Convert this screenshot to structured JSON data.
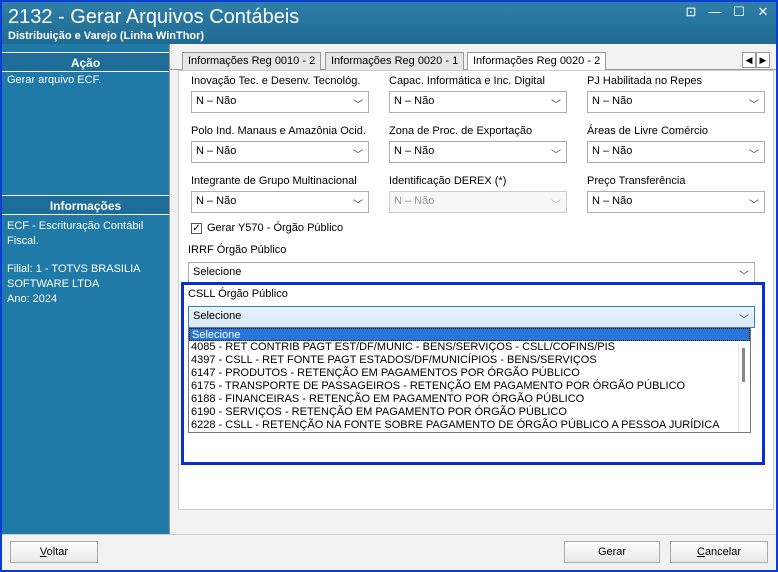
{
  "window": {
    "title": "2132 - Gerar Arquivos Contábeis",
    "subtitle": "Distribuição e Varejo (Linha WinThor)",
    "controls": [
      "⊡",
      "—",
      "☐",
      "✕"
    ]
  },
  "sidebar": {
    "acao_header": "Ação",
    "acao_text": "Gerar arquivo ECF.",
    "info_header": "Informações",
    "info_line1": "ECF - Escrituração Contábil",
    "info_line2": "Fiscal.",
    "info_line3": "Filial: 1 - TOTVS BRASILIA",
    "info_line4": "SOFTWARE LTDA",
    "info_line5": "Ano: 2024"
  },
  "tabs": [
    {
      "label": "Informações Reg 0010 - 2"
    },
    {
      "label": "Informações Reg 0020 - 1"
    },
    {
      "label": "Informações Reg 0020 - 2"
    }
  ],
  "tab_arrows": {
    "left": "◀",
    "right": "▶"
  },
  "fields": {
    "inovacao": {
      "label": "Inovação Tec. e Desenv. Tecnológ.",
      "value": "N – Não"
    },
    "capac": {
      "label": "Capac. Informática e Inc. Digital",
      "value": "N – Não"
    },
    "pj_repes": {
      "label": "PJ Habilitada no Repes",
      "value": "N – Não"
    },
    "polo": {
      "label": "Polo Ind. Manaus e Amazônia Ocid.",
      "value": "N – Não"
    },
    "zona": {
      "label": "Zona de Proc. de Exportação",
      "value": "N – Não"
    },
    "areas": {
      "label": "Áreas de Livre Comércio",
      "value": "N – Não"
    },
    "integrante": {
      "label": "Integrante de Grupo Multinacional",
      "value": "N – Não"
    },
    "derex": {
      "label": "Identificação DEREX (*)",
      "value": "N – Não"
    },
    "preco": {
      "label": "Preço Transferência",
      "value": "N – Não"
    }
  },
  "gerar_y570": {
    "label": "Gerar Y570 - Órgão Público",
    "checked": "✓"
  },
  "irrf": {
    "label": "IRRF Órgão Público",
    "value": "Selecione"
  },
  "csll": {
    "label": "CSLL Órgão Público",
    "value": "Selecione"
  },
  "csll_options": [
    "Selecione",
    "4085 - RET CONTRIB PAGT EST/DF/MUNIC - BENS/SERVIÇOS - CSLL/COFINS/PIS",
    "4397 - CSLL - RET FONTE PAGT ESTADOS/DF/MUNICÍPIOS - BENS/SERVIÇOS",
    "6147 - PRODUTOS - RETENÇÃO EM PAGAMENTOS POR ÓRGÃO PÚBLICO",
    "6175 - TRANSPORTE DE PASSAGEIROS - RETENÇÃO EM PAGAMENTO POR ÓRGÃO PÚBLICO",
    "6188 - FINANCEIRAS - RETENÇÃO EM PAGAMENTO POR ÓRGÃO PÚBLICO",
    "6190 - SERVIÇOS - RETENÇÃO EM PAGAMENTO POR ÓRGÃO PÚBLICO",
    "6228 - CSLL - RETENÇÃO NA FONTE SOBRE PAGAMENTO DE ÓRGÃO PÚBLICO A PESSOA JURÍDICA"
  ],
  "footer": {
    "voltar_prefix": "",
    "voltar_u": "V",
    "voltar_rest": "oltar",
    "gerar": "Gerar",
    "cancelar_u": "C",
    "cancelar_rest": "ancelar"
  },
  "chevron": "﹀"
}
